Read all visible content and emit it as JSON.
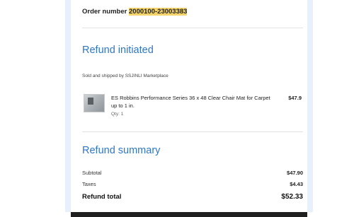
{
  "order": {
    "label": "Order number",
    "number_part1": "2000100",
    "number_sep": "-",
    "number_part2": "23003383"
  },
  "refund": {
    "title": "Refund initiated",
    "sold_by": "Sold and shipped by SSJINLI Marketplace"
  },
  "item": {
    "name": "ES Robbins Performance Series 36 x 48 Clear Chair Mat for Carpet up to 1 in.",
    "qty": "Qty: 1",
    "price": "$47.9"
  },
  "summary": {
    "title": "Refund summary",
    "subtotal_label": "Subtotal",
    "subtotal_value": "$47.90",
    "taxes_label": "Taxes",
    "taxes_value": "$4.43",
    "total_label": "Refund total",
    "total_value": "$52.33"
  },
  "colors": {
    "accent": "#2f76c6",
    "highlight": "#f3d36a",
    "frame": "#e8f1fb"
  }
}
